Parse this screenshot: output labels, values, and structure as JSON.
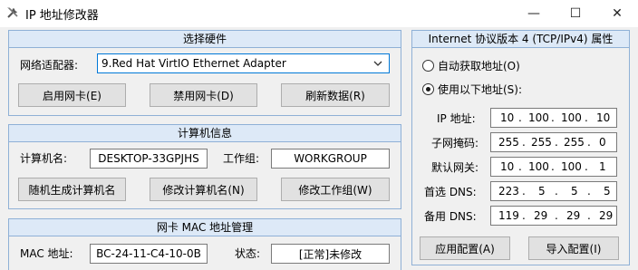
{
  "window": {
    "title": "IP 地址修改器",
    "min_symbol": "—",
    "max_symbol": "☐",
    "close_symbol": "✕"
  },
  "hardware": {
    "header": "选择硬件",
    "adapter_label": "网络适配器:",
    "adapter_value": "9.Red Hat VirtIO Ethernet Adapter",
    "enable_button": "启用网卡(E)",
    "disable_button": "禁用网卡(D)",
    "refresh_button": "刷新数据(R)"
  },
  "computer": {
    "header": "计算机信息",
    "name_label": "计算机名:",
    "name_value": "DESKTOP-33GPJHS",
    "workgroup_label": "工作组:",
    "workgroup_value": "WORKGROUP",
    "random_button": "随机生成计算机名",
    "rename_button": "修改计算机名(N)",
    "workgroup_button": "修改工作组(W)"
  },
  "mac": {
    "header": "网卡 MAC 地址管理",
    "mac_label": "MAC 地址:",
    "mac_value": "BC-24-11-C4-10-0B",
    "status_label": "状态:",
    "status_value": "[正常]未修改"
  },
  "tcpip": {
    "header": "Internet 协议版本 4 (TCP/IPv4) 属性",
    "auto_option": "自动获取地址(O)",
    "manual_option": "使用以下地址(S):",
    "selected": "manual",
    "ip_label": "IP 地址:",
    "ip": [
      "10",
      "100",
      "100",
      "10"
    ],
    "mask_label": "子网掩码:",
    "mask": [
      "255",
      "255",
      "255",
      "0"
    ],
    "gateway_label": "默认网关:",
    "gateway": [
      "10",
      "100",
      "100",
      "1"
    ],
    "dns1_label": "首选 DNS:",
    "dns1": [
      "223",
      "5",
      "5",
      "5"
    ],
    "dns2_label": "备用 DNS:",
    "dns2": [
      "119",
      "29",
      "29",
      "29"
    ],
    "apply_button": "应用配置(A)",
    "import_button": "导入配置(I)"
  },
  "colors": {
    "panel_border": "#8fb0d6",
    "panel_header": "#dde9f7",
    "focus_border": "#0078d7"
  }
}
